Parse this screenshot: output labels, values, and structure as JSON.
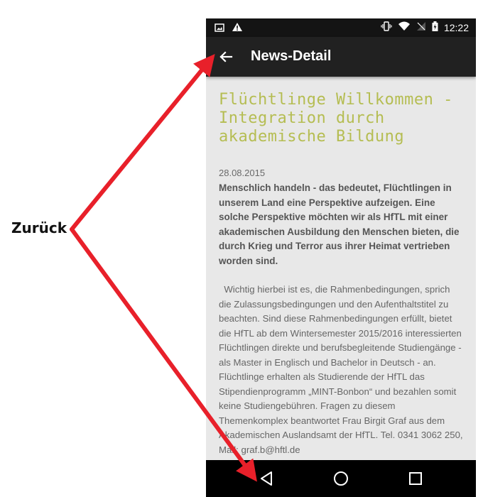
{
  "annotation": {
    "label": "Zurück",
    "arrow_color": "#e8202a"
  },
  "status_bar": {
    "left_icons": [
      "image-icon",
      "warning-icon"
    ],
    "right_icons": [
      "vibrate-icon",
      "wifi-icon",
      "no-signal-icon",
      "battery-charging-icon"
    ],
    "time": "12:22"
  },
  "app_bar": {
    "back_icon": "arrow-left-icon",
    "title": "News-Detail"
  },
  "article": {
    "headline": "Flüchtlinge Willkommen - Integration durch akademische Bildung",
    "date": "28.08.2015",
    "lead": "Menschlich handeln - das bedeutet, Flüchtlingen in unserem Land eine Perspektive aufzeigen. Eine solche Perspektive möchten wir als HfTL mit einer akademischen Ausbildung den Menschen bieten, die durch Krieg und Terror aus ihrer Heimat vertrieben worden sind.",
    "body": "Wichtig hierbei ist es, die Rahmenbedingungen, sprich die Zulassungsbedingungen und den Aufenthaltstitel zu beachten. Sind diese Rahmenbedingungen erfüllt, bietet die HfTL ab dem Wintersemester 2015/2016 interessierten Flüchtlingen direkte und berufsbegleitende Studiengänge - als Master in Englisch und Bachelor in Deutsch - an. Flüchtlinge erhalten als Studierende der HfTL das Stipendienprogramm „MINT-Bonbon“ und bezahlen somit keine Studiengebühren. Fragen zu diesem Themenkomplex beantwortet Frau Birgit Graf aus dem Akademischen Auslandsamt der HfTL. Tel. 0341 3062 250, Mail: graf.b@hftl.de"
  },
  "nav_bar": {
    "buttons": [
      "nav-back-icon",
      "nav-home-icon",
      "nav-recents-icon"
    ]
  },
  "colors": {
    "status_bar": "#141414",
    "app_bar": "#212121",
    "content_bg": "#e8e8e8",
    "headline": "#b5bd52",
    "nav_bar": "#000000"
  }
}
